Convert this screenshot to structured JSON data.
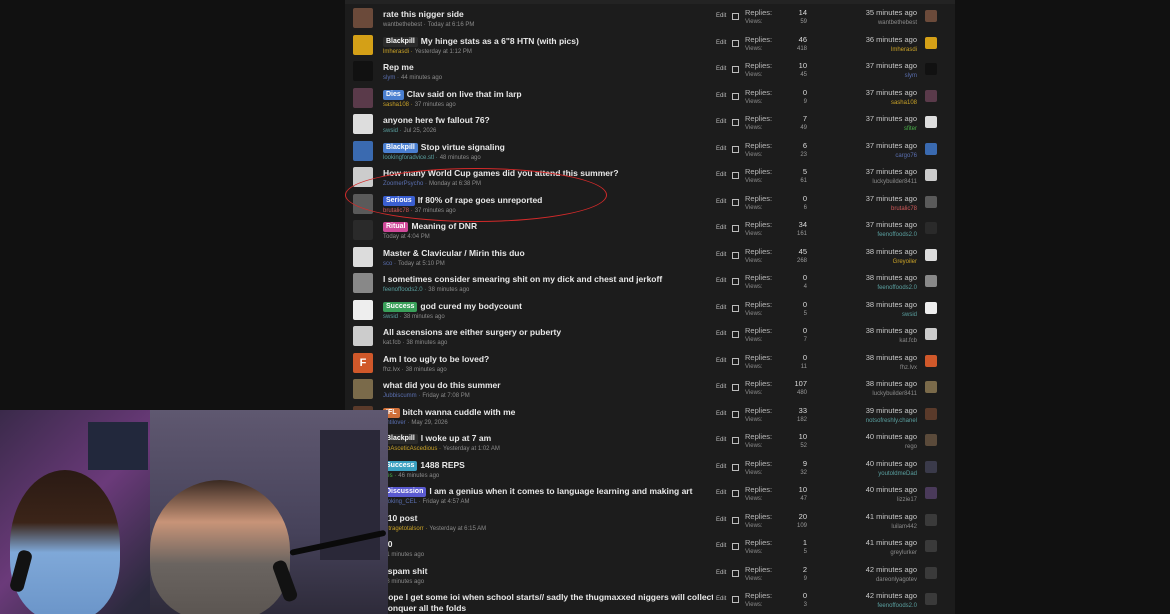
{
  "forum": {
    "edit_label": "Edit",
    "replies_label": "Replies:",
    "views_label": "Views:",
    "threads": [
      {
        "title": "rate this nigger side",
        "prefix": "",
        "prefix_color": "",
        "user": "wantbethebest",
        "date": "Today at 6:16 PM",
        "replies": "14",
        "views": "59",
        "last_time": "35 minutes ago",
        "last_user": "wantbethebest",
        "avatar_color": "#6b4a3a",
        "user_color": "#8b8b8b",
        "last_user_color": "#8b8b8b"
      },
      {
        "title": "My hinge stats as a 6\"8 HTN (with pics)",
        "prefix": "Blackpill",
        "prefix_color": "#2b2b2b",
        "user": "lmherasdi",
        "date": "Yesterday at 1:12 PM",
        "replies": "46",
        "views": "418",
        "last_time": "36 minutes ago",
        "last_user": "lmherasdi",
        "avatar_color": "#d4a017",
        "user_color": "#c9a227",
        "last_user_color": "#c9a227"
      },
      {
        "title": "Rep me",
        "prefix": "",
        "prefix_color": "",
        "user": "slym",
        "date": "44 minutes ago",
        "replies": "10",
        "views": "45",
        "last_time": "37 minutes ago",
        "last_user": "slym",
        "avatar_color": "#111111",
        "user_color": "#5a6fb0",
        "last_user_color": "#5a6fb0"
      },
      {
        "title": "Clav said on live that im larp",
        "prefix": "Dies",
        "prefix_color": "#4a7fd0",
        "user": "sasha108",
        "date": "37 minutes ago",
        "replies": "0",
        "views": "9",
        "last_time": "37 minutes ago",
        "last_user": "sasha108",
        "avatar_color": "#5a3a4a",
        "user_color": "#c9a227",
        "last_user_color": "#c9a227"
      },
      {
        "title": "anyone here fw fallout 76?",
        "prefix": "",
        "prefix_color": "",
        "user": "swsid",
        "date": "Jul 25, 2026",
        "replies": "7",
        "views": "49",
        "last_time": "37 minutes ago",
        "last_user": "sfiter",
        "avatar_color": "#dddddd",
        "user_color": "#5aa0a0",
        "last_user_color": "#4ab04a"
      },
      {
        "title": "Stop virtue signaling",
        "prefix": "Blackpill",
        "prefix_color": "#4a7fd0",
        "user": "lookingforadvice.stl",
        "date": "48 minutes ago",
        "replies": "6",
        "views": "23",
        "last_time": "37 minutes ago",
        "last_user": "cargo76",
        "avatar_color": "#3a6ab0",
        "user_color": "#5aa0a0",
        "last_user_color": "#5a6fb0"
      },
      {
        "title": "How many World Cup games did you attend this summer?",
        "prefix": "",
        "prefix_color": "",
        "user": "ZoomerPsycho",
        "date": "Monday at 6:38 PM",
        "replies": "5",
        "views": "61",
        "last_time": "37 minutes ago",
        "last_user": "luckybuilder8411",
        "avatar_color": "#cccccc",
        "user_color": "#5a6fb0",
        "last_user_color": "#8b8b8b"
      },
      {
        "title": "If 80% of rape goes unreported",
        "prefix": "Serious",
        "prefix_color": "#3a5fd0",
        "user": "brutalic78",
        "date": "37 minutes ago",
        "replies": "0",
        "views": "6",
        "last_time": "37 minutes ago",
        "last_user": "brutalic78",
        "avatar_color": "#5a5a5a",
        "user_color": "#d05a5a",
        "last_user_color": "#d05a5a"
      },
      {
        "title": "Meaning of DNR",
        "prefix": "Ritual",
        "prefix_color": "#d04a9a",
        "user": "",
        "date": "Today at 4:04 PM",
        "replies": "34",
        "views": "161",
        "last_time": "37 minutes ago",
        "last_user": "feenoffoods2.0",
        "avatar_color": "#2a2a2a",
        "user_color": "#8b8b8b",
        "last_user_color": "#5aa0a0"
      },
      {
        "title": "Master & Clavicular / Mirin this duo",
        "prefix": "",
        "prefix_color": "",
        "user": "sco",
        "date": "Today at 5:10 PM",
        "replies": "45",
        "views": "268",
        "last_time": "38 minutes ago",
        "last_user": "Greyoiler",
        "avatar_color": "#dcdcdc",
        "user_color": "#5a6fb0",
        "last_user_color": "#c9a227"
      },
      {
        "title": "I sometimes consider smearing shit on my dick and chest and jerkoff",
        "prefix": "",
        "prefix_color": "",
        "user": "feenoffoods2.0",
        "date": "38 minutes ago",
        "replies": "0",
        "views": "4",
        "last_time": "38 minutes ago",
        "last_user": "feenoffoods2.0",
        "avatar_color": "#888888",
        "user_color": "#5aa0a0",
        "last_user_color": "#5aa0a0"
      },
      {
        "title": "god cured my bodycount",
        "prefix": "Success",
        "prefix_color": "#3aa05a",
        "user": "swsid",
        "date": "38 minutes ago",
        "replies": "0",
        "views": "5",
        "last_time": "38 minutes ago",
        "last_user": "swsid",
        "avatar_color": "#eeeeee",
        "user_color": "#5aa0a0",
        "last_user_color": "#5aa0a0"
      },
      {
        "title": "All ascensions are either surgery or puberty",
        "prefix": "",
        "prefix_color": "",
        "user": "kat.fcb",
        "date": "38 minutes ago",
        "replies": "0",
        "views": "7",
        "last_time": "38 minutes ago",
        "last_user": "kat.fcb",
        "avatar_color": "#cccccc",
        "user_color": "#8b8b8b",
        "last_user_color": "#8b8b8b"
      },
      {
        "title": "Am I too ugly to be loved?",
        "prefix": "",
        "prefix_color": "",
        "user": "fhz.lvx",
        "date": "38 minutes ago",
        "replies": "0",
        "views": "11",
        "last_time": "38 minutes ago",
        "last_user": "fhz.lvx",
        "avatar_color": "#d0582a",
        "avatar_letter": "F",
        "user_color": "#8b8b8b",
        "last_user_color": "#8b8b8b"
      },
      {
        "title": "what did you do this summer",
        "prefix": "",
        "prefix_color": "",
        "user": "Jubbiscumm",
        "date": "Friday at 7:08 PM",
        "replies": "107",
        "views": "480",
        "last_time": "38 minutes ago",
        "last_user": "luckybuilder8411",
        "avatar_color": "#7a6a4a",
        "user_color": "#5a6fb0",
        "last_user_color": "#8b8b8b"
      },
      {
        "title": "bitch wanna cuddle with me",
        "prefix": "IFL",
        "prefix_color": "#d0703a",
        "user": "antilover",
        "date": "May 29, 2026",
        "replies": "33",
        "views": "182",
        "last_time": "39 minutes ago",
        "last_user": "notsofreshly.chanel",
        "avatar_color": "#5a3a2a",
        "user_color": "#5a6fb0",
        "last_user_color": "#5aa0a0"
      },
      {
        "title": "I woke up at 7 am",
        "prefix": "Blackpill",
        "prefix_color": "#2b2b2b",
        "user": "BoAsceticAscedious",
        "date": "Yesterday at 1:02 AM",
        "replies": "10",
        "views": "52",
        "last_time": "40 minutes ago",
        "last_user": "rego",
        "avatar_color": "#5a4a3a",
        "user_color": "#c9a227",
        "last_user_color": "#8b8b8b"
      },
      {
        "title": "1488 REPS",
        "prefix": "Success",
        "prefix_color": "#3aa0c0",
        "user": "ffes",
        "date": "46 minutes ago",
        "replies": "9",
        "views": "32",
        "last_time": "40 minutes ago",
        "last_user": "youtoldmeDad",
        "avatar_color": "#3a3a4a",
        "user_color": "#4ab04a",
        "last_user_color": "#5aa0a0"
      },
      {
        "title": "I am a genius when it comes to language learning and making art",
        "prefix": "Discussion",
        "prefix_color": "#5a5ad0",
        "user": "looking_CEL",
        "date": "Friday at 4:57 AM",
        "replies": "10",
        "views": "47",
        "last_time": "40 minutes ago",
        "last_user": "lizzie17",
        "avatar_color": "#4a3a5a",
        "user_color": "#5a6fb0",
        "last_user_color": "#8b8b8b"
      },
      {
        "title": "710 post",
        "prefix": "",
        "prefix_color": "",
        "user": "retragetotalsorr",
        "date": "Yesterday at 6:15 AM",
        "replies": "20",
        "views": "109",
        "last_time": "41 minutes ago",
        "last_user": "luilam442",
        "avatar_color": "#3a3a3a",
        "user_color": "#c9a227",
        "last_user_color": "#8b8b8b"
      },
      {
        "title": "00",
        "prefix": "",
        "prefix_color": "",
        "user": "",
        "date": "41 minutes ago",
        "replies": "1",
        "views": "5",
        "last_time": "41 minutes ago",
        "last_user": "greylurker",
        "avatar_color": "#3a3a3a",
        "user_color": "#8b8b8b",
        "last_user_color": "#8b8b8b"
      },
      {
        "title": "I spam shit",
        "prefix": "",
        "prefix_color": "",
        "user": "",
        "date": "48 minutes ago",
        "replies": "2",
        "views": "9",
        "last_time": "42 minutes ago",
        "last_user": "dareonlyagotev",
        "avatar_color": "#3a3a3a",
        "user_color": "#8b8b8b",
        "last_user_color": "#8b8b8b"
      },
      {
        "title": "hope I get some ioi when school starts// sadly the thugmaxxed niggers will collect and",
        "prefix": "",
        "prefix_color": "",
        "user": "",
        "date": "",
        "replies": "0",
        "views": "3",
        "last_time": "42 minutes ago",
        "last_user": "feenoffoods2.0",
        "avatar_color": "#3a3a3a",
        "user_color": "#8b8b8b",
        "last_user_color": "#5aa0a0"
      }
    ],
    "extra_line": "conquer all the folds"
  }
}
